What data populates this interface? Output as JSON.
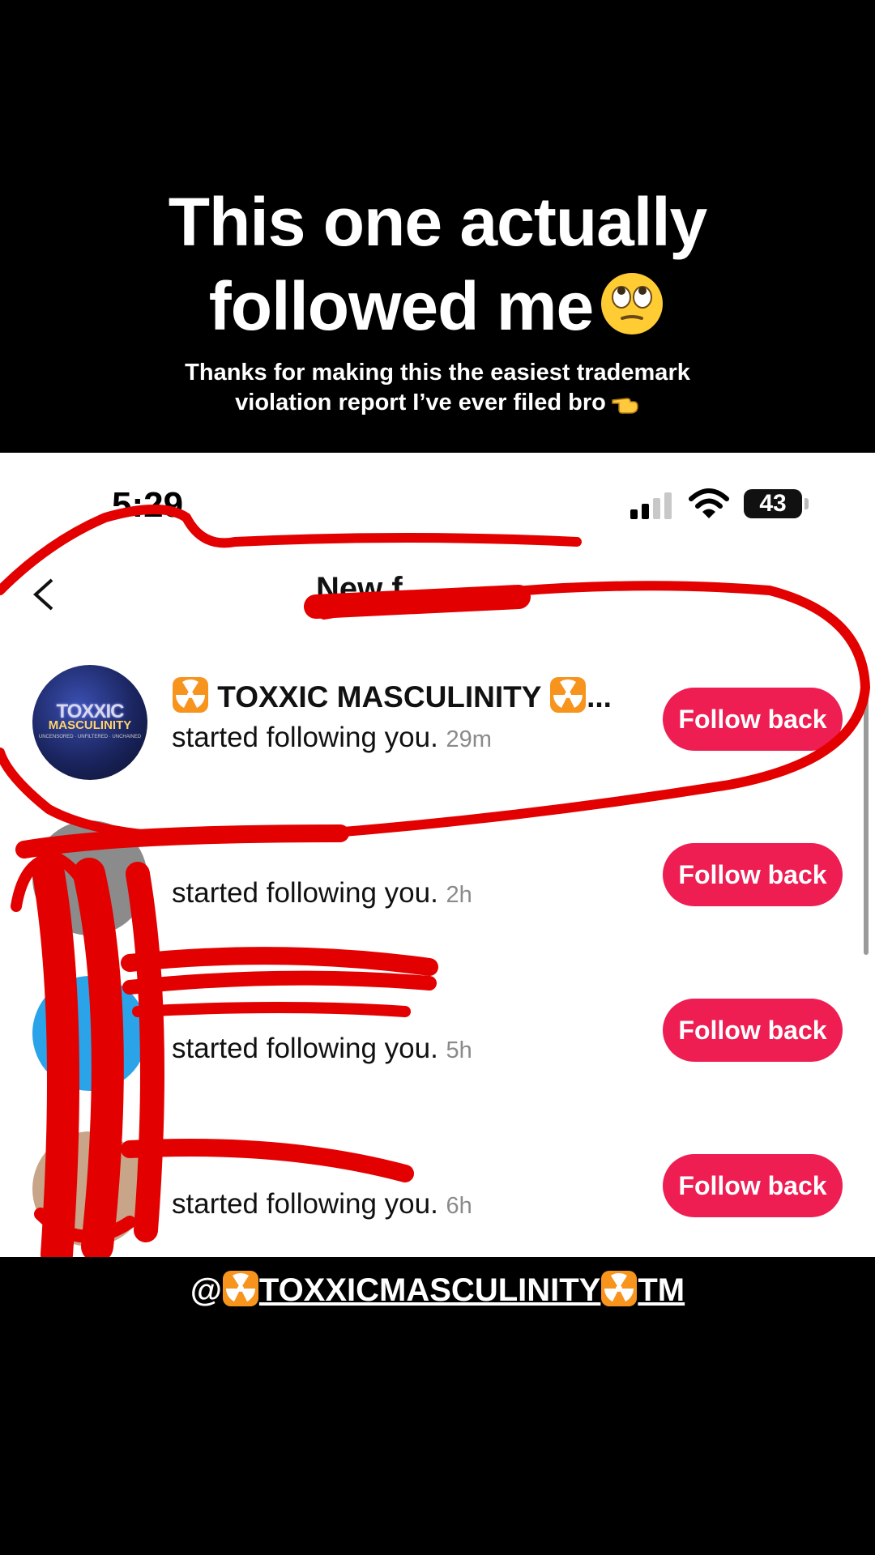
{
  "overlay": {
    "title_line1": "This one actually",
    "title_line2": "followed me",
    "title_emoji": "eye-roll-emoji",
    "subtitle_line1": "Thanks for making this the easiest trademark",
    "subtitle_line2": "violation report I’ve ever filed bro",
    "subtitle_emoji": "pointing-hand-emoji"
  },
  "status_bar": {
    "time": "5:29",
    "battery": "43"
  },
  "header": {
    "back_icon": "chevron-left-icon",
    "title": "New f"
  },
  "notifications": [
    {
      "name": "TOXXIC MASCULINITY",
      "name_suffix": "...",
      "avatar_text_1": "TOXXIC",
      "avatar_text_2": "MASCULINITY",
      "avatar_text_3": "UNCENSORED · UNFILTERED · UNCHAINED",
      "action": "started following you.",
      "time": "29m",
      "button": "Follow back"
    },
    {
      "name": "",
      "action": "started following you.",
      "time": "2h",
      "button": "Follow back"
    },
    {
      "name": "",
      "action": "started following you.",
      "time": "5h",
      "button": "Follow back"
    },
    {
      "name": "",
      "action": "started following you.",
      "time": "6h",
      "button": "Follow back"
    }
  ],
  "footer_handle": {
    "at": "@",
    "text": "TOXXICMASCULINITY",
    "suffix": "TM"
  },
  "colors": {
    "accent": "#ee1d52",
    "scribble": "#e30000",
    "radioactive": "#f7941d"
  }
}
